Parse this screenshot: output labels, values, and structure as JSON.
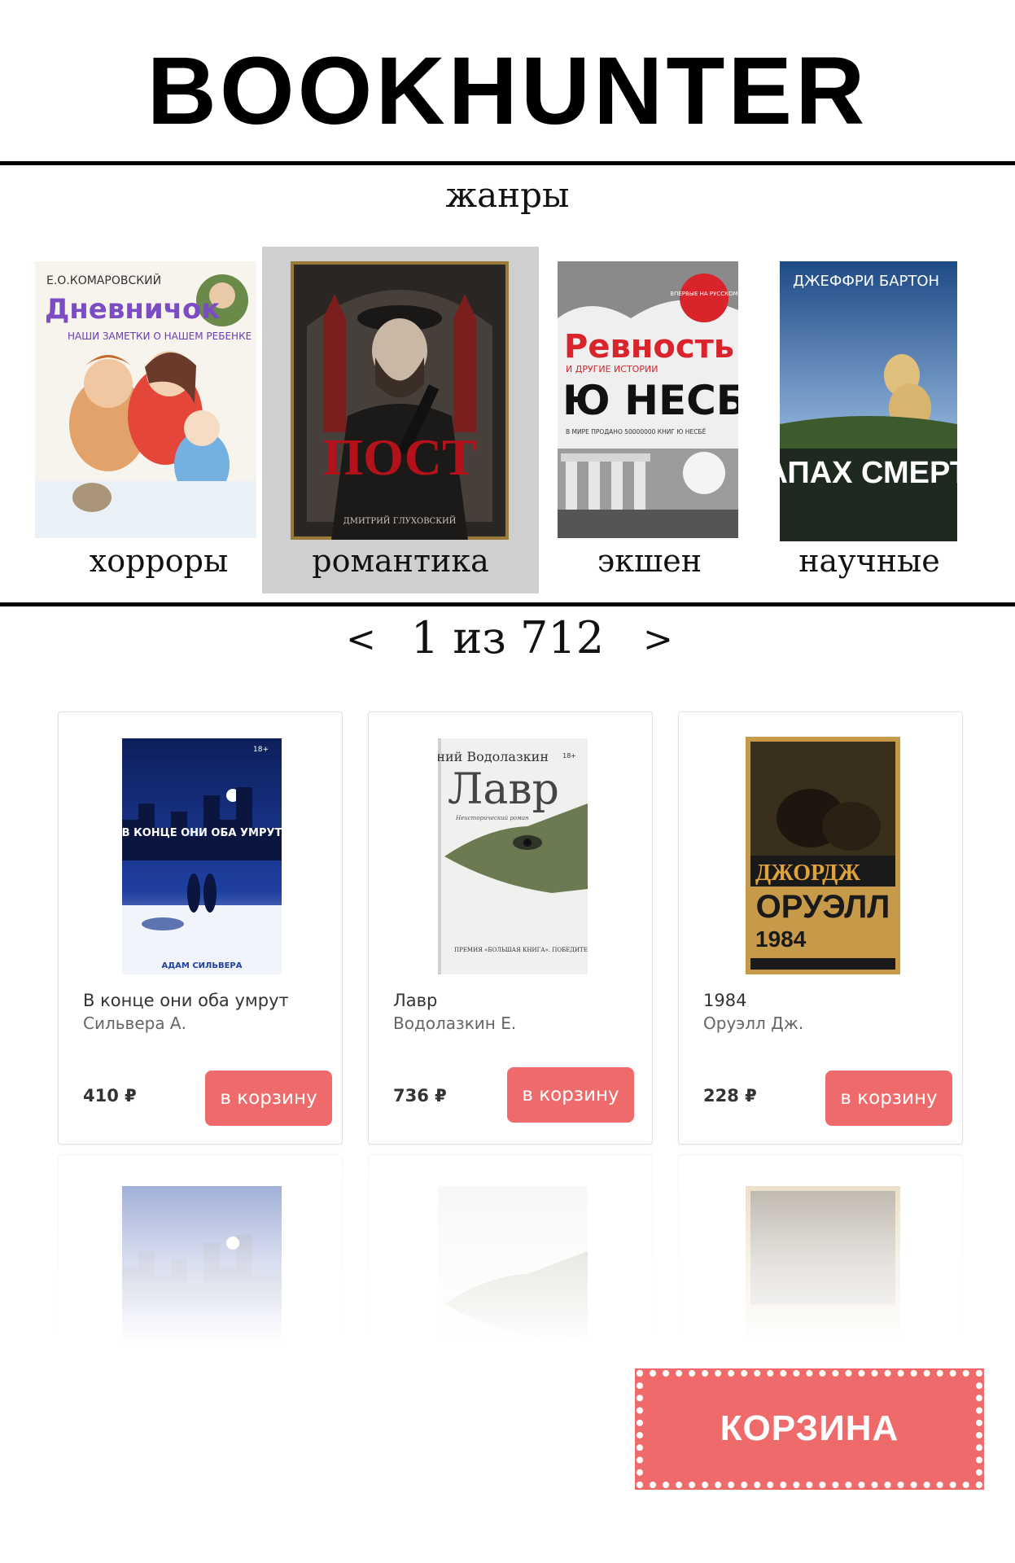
{
  "header": {
    "logo": "BOOKHUNTER"
  },
  "genres": {
    "title": "жанры",
    "items": [
      {
        "label": "хорроры",
        "selected": false,
        "cover": {
          "author": "Е.О.КОМАРОВСКИЙ",
          "title": "Дневничок",
          "subtitle": "НАШИ ЗАМЕТКИ О НАШЕМ РЕБЕНКЕ"
        }
      },
      {
        "label": "романтика",
        "selected": true,
        "cover": {
          "title": "ПОСТ",
          "author": "ДМИТРИЙ ГЛУХОВСКИЙ"
        }
      },
      {
        "label": "экшен",
        "selected": false,
        "cover": {
          "badge": "ВПЕРВЫЕ НА РУССКОМ",
          "title": "Ревность",
          "subtitle": "И ДРУГИЕ ИСТОРИИ",
          "author": "Ю НЕСБЁ",
          "note": "В МИРЕ ПРОДАНО 50000000 КНИГ Ю НЕСБЁ"
        }
      },
      {
        "label": "научные",
        "selected": false,
        "cover": {
          "author": "ДЖЕФФРИ БАРТОН",
          "title": "ЗАПАХ СМЕРТИ"
        }
      }
    ]
  },
  "pager": {
    "prev": "<",
    "text": "1 из 712",
    "next": ">",
    "current": 1,
    "total": 712
  },
  "products": [
    {
      "title": "В конце они оба умрут",
      "author": "Сильвера А.",
      "price": "410 ₽",
      "button": "в корзину",
      "cover": {
        "title": "В КОНЦЕ ОНИ ОБА УМРУТ",
        "author": "АДАМ СИЛЬВЕРА",
        "age": "18+"
      }
    },
    {
      "title": "Лавр",
      "author": "Водолазкин Е.",
      "price": "736 ₽",
      "button": "в корзину",
      "cover": {
        "author": "Евгений Водолазкин",
        "title": "Лавр",
        "age": "18+",
        "subtitle": "Неисторический роман",
        "prize": "ПРЕМИЯ «БОЛЬШАЯ КНИГА». ПОБЕДИТЕЛЬ"
      }
    },
    {
      "title": "1984",
      "author": "Оруэлл Дж.",
      "price": "228 ₽",
      "button": "в корзину",
      "cover": {
        "author_first": "ДЖОРДЖ",
        "author_last": "ОРУЭЛЛ",
        "title": "1984"
      }
    }
  ],
  "cart": {
    "label": "КОРЗИНА"
  },
  "colors": {
    "accent": "#ef6a6a",
    "selected_genre_bg": "#cfcfcf",
    "rule": "#000000"
  }
}
